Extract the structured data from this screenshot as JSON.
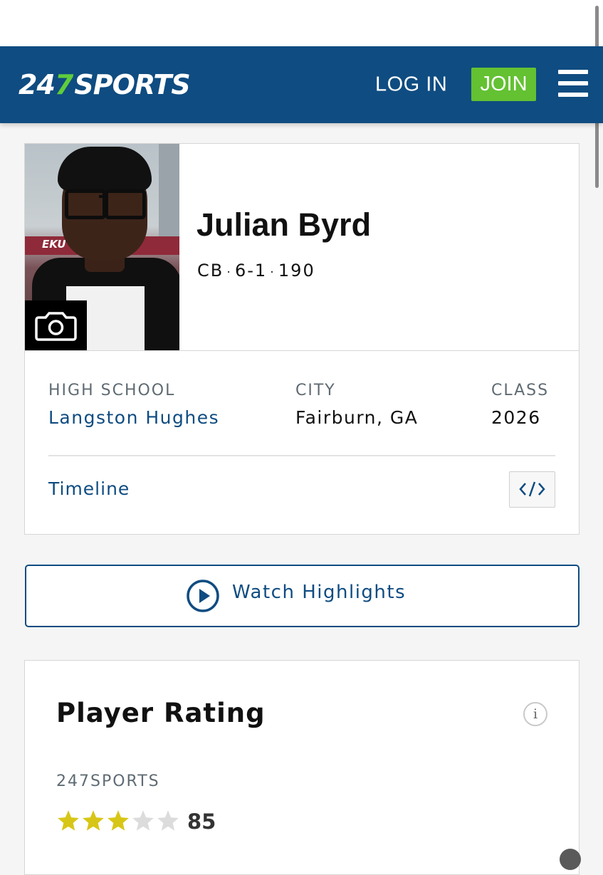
{
  "header": {
    "logo_num": "24",
    "logo_seven": "7",
    "logo_word": "SPORTS",
    "login_label": "LOG IN",
    "join_label": "JOIN",
    "brand_color": "#0f4c81",
    "join_color": "#63c132"
  },
  "player": {
    "name": "Julian Byrd",
    "position": "CB",
    "height": "6-1",
    "weight": "190",
    "photo_stand_text": "EKU"
  },
  "details": {
    "high_school_label": "HIGH SCHOOL",
    "high_school": "Langston Hughes",
    "city_label": "CITY",
    "city": "Fairburn, GA",
    "class_label": "CLASS",
    "class": "2026",
    "timeline_label": "Timeline"
  },
  "highlights": {
    "label": "Watch Highlights"
  },
  "rating": {
    "title": "Player Rating",
    "info_icon": "i",
    "source": "247SPORTS",
    "stars_filled": 3,
    "stars_total": 5,
    "score": "85"
  }
}
